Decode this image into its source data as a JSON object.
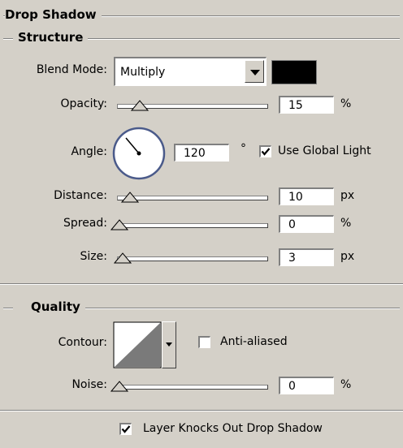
{
  "panel": {
    "title": "Drop Shadow",
    "structure": {
      "title": "Structure",
      "blend_mode": {
        "label": "Blend Mode:",
        "value": "Multiply",
        "color": "#000000"
      },
      "opacity": {
        "label": "Opacity:",
        "value": "15",
        "unit": "%",
        "slider_fraction": 0.15
      },
      "angle": {
        "label": "Angle:",
        "value": "120",
        "unit": "°",
        "use_global_light": "Use Global Light",
        "use_global_light_checked": true
      },
      "distance": {
        "label": "Distance:",
        "value": "10",
        "unit": "px",
        "slider_fraction": 0.1
      },
      "spread": {
        "label": "Spread:",
        "value": "0",
        "unit": "%",
        "slider_fraction": 0
      },
      "size": {
        "label": "Size:",
        "value": "3",
        "unit": "px",
        "slider_fraction": 0.02
      }
    },
    "quality": {
      "title": "Quality",
      "contour": {
        "label": "Contour:",
        "anti_aliased": "Anti-aliased",
        "anti_aliased_checked": false
      },
      "noise": {
        "label": "Noise:",
        "value": "0",
        "unit": "%",
        "slider_fraction": 0
      }
    },
    "layer_knocks_out": {
      "label": "Layer Knocks Out Drop Shadow",
      "checked": true
    }
  }
}
